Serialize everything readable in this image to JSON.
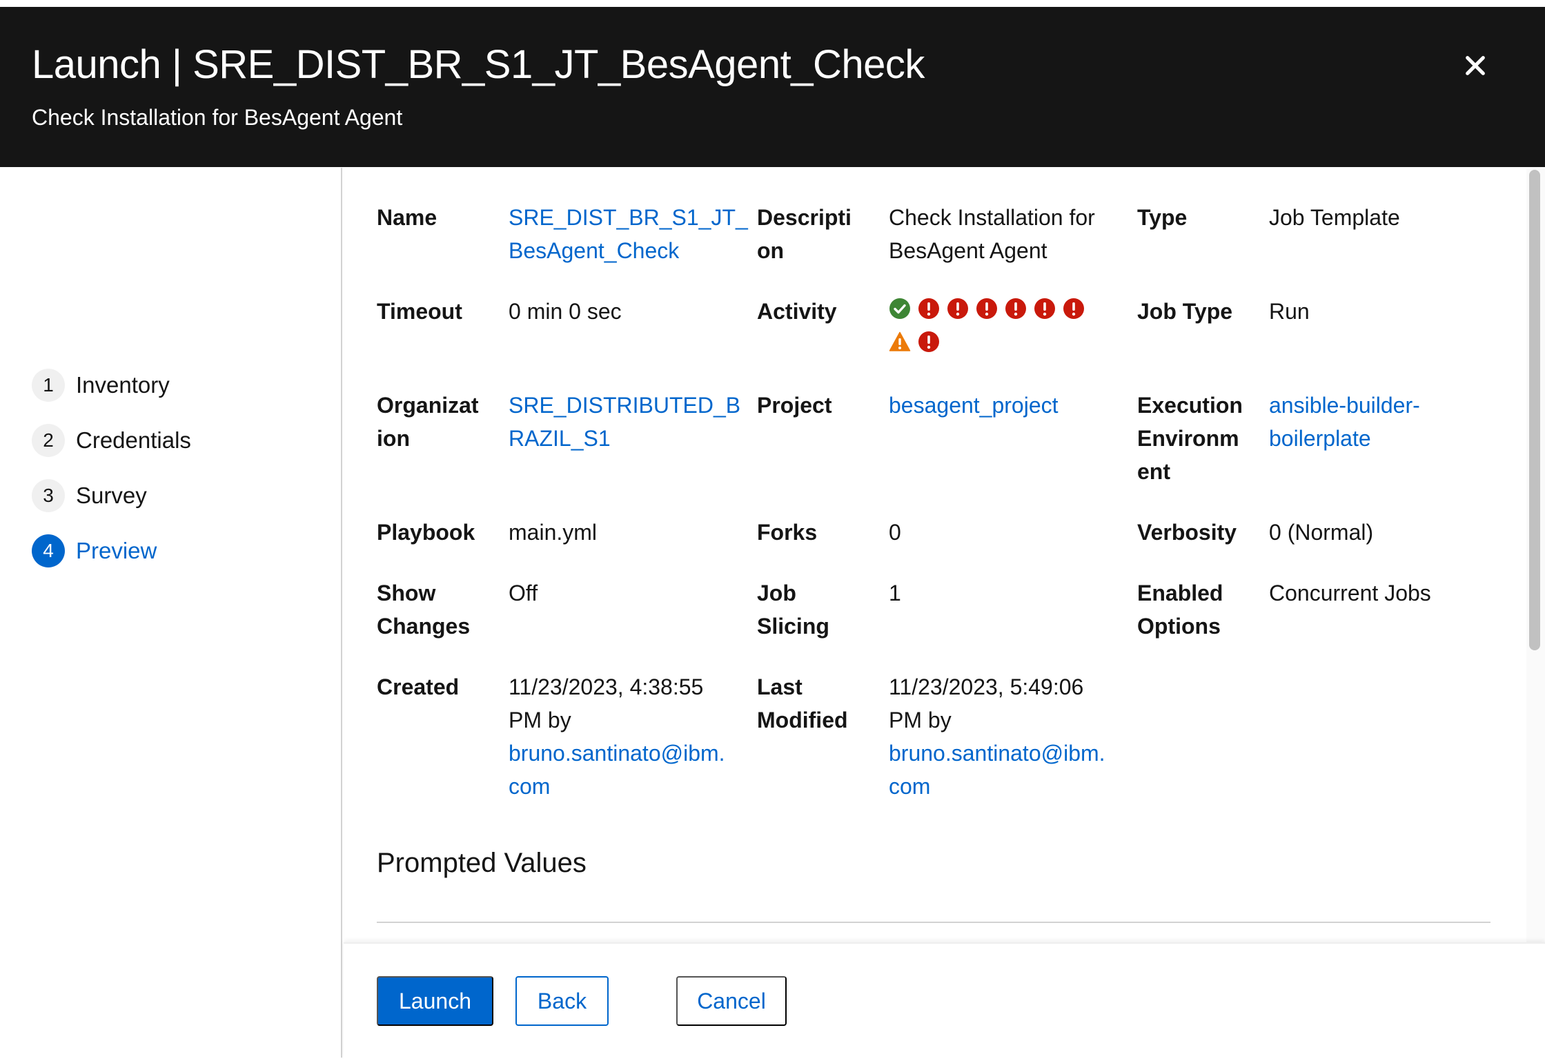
{
  "modal": {
    "title": "Launch | SRE_DIST_BR_S1_JT_BesAgent_Check",
    "subtitle": "Check Installation for BesAgent Agent",
    "close_icon": "close-icon"
  },
  "wizard_nav": {
    "steps": [
      {
        "number": "1",
        "label": "Inventory"
      },
      {
        "number": "2",
        "label": "Credentials"
      },
      {
        "number": "3",
        "label": "Survey"
      },
      {
        "number": "4",
        "label": "Preview",
        "current": true
      }
    ]
  },
  "details": {
    "name": {
      "label": "Name",
      "value": "SRE_DIST_BR_S1_JT_\nBesAgent_Check"
    },
    "description": {
      "label": "Descripti\non",
      "value": "Check Installation for\nBesAgent Agent"
    },
    "type": {
      "label": "Type",
      "value": "Job Template"
    },
    "timeout": {
      "label": "Timeout",
      "value": "0 min 0 sec"
    },
    "activity": {
      "label": "Activity",
      "statuses": [
        "success",
        "failed",
        "failed",
        "failed",
        "failed",
        "failed",
        "failed",
        "warning",
        "failed"
      ]
    },
    "job_type": {
      "label": "Job Type",
      "value": "Run"
    },
    "organization": {
      "label": "Organizat\nion",
      "value": "SRE_DISTRIBUTED_B\nRAZIL_S1"
    },
    "project": {
      "label": "Project",
      "value": "besagent_project"
    },
    "execution_environment": {
      "label": "Execution\nEnvironm\nent",
      "value": "ansible-builder-\nboilerplate"
    },
    "playbook": {
      "label": "Playbook",
      "value": "main.yml"
    },
    "forks": {
      "label": "Forks",
      "value": "0"
    },
    "verbosity": {
      "label": "Verbosity",
      "value": "0 (Normal)"
    },
    "show_changes": {
      "label": "Show\nChanges",
      "value": "Off"
    },
    "job_slicing": {
      "label": "Job\nSlicing",
      "value": "1"
    },
    "enabled_options": {
      "label": "Enabled\nOptions",
      "value": "Concurrent Jobs"
    },
    "created": {
      "label": "Created",
      "date": "11/23/2023, 4:38:55\nPM by",
      "user": "bruno.santinato@ibm.\ncom"
    },
    "last_modified": {
      "label": "Last\nModified",
      "date": "11/23/2023, 5:49:06\nPM by",
      "user": "bruno.santinato@ibm.\ncom"
    }
  },
  "prompted_values": {
    "title": "Prompted Values"
  },
  "footer": {
    "launch_label": "Launch",
    "back_label": "Back",
    "cancel_label": "Cancel"
  },
  "colors": {
    "header_bg": "#151515",
    "link": "#0066cc",
    "primary": "#0066cc",
    "success": "#3e8635",
    "danger": "#c9190b",
    "warning": "#ec7a08"
  }
}
